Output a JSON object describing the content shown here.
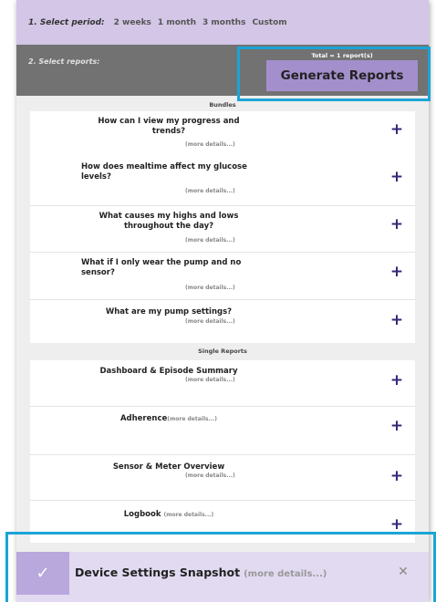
{
  "period": {
    "label": "1. Select period:",
    "options": [
      "2 weeks",
      "1 month",
      "3 months",
      "Custom"
    ]
  },
  "reports": {
    "label": "2. Select reports:",
    "total": "Total = 1 report(s)",
    "generate_label": "Generate Reports"
  },
  "bundles": {
    "heading": "Bundles",
    "items": [
      {
        "title": "How can I view my progress and trends?",
        "more": "(more details...)"
      },
      {
        "title": "How does mealtime affect my glucose levels?",
        "more": "(more details...)"
      },
      {
        "title": "What causes my highs and lows throughout the day?",
        "more": "(more details...)"
      },
      {
        "title": "What if I only wear the pump and no sensor?",
        "more": "(more details...)"
      },
      {
        "title": "What are my pump settings?",
        "more": "(more details...)"
      }
    ]
  },
  "singles": {
    "heading": "Single Reports",
    "items": [
      {
        "title": "Dashboard & Episode Summary",
        "more": "(more details...)"
      },
      {
        "title": "Adherence",
        "more": "(more details...)"
      },
      {
        "title": "Sensor & Meter Overview",
        "more": "(more details...)"
      },
      {
        "title": "Logbook",
        "more": "(more details...)"
      }
    ]
  },
  "plus_glyph": "+",
  "selected": {
    "title": "Device Settings Snapshot",
    "more": "(more details...)",
    "check_glyph": "✓",
    "close_glyph": "✕"
  },
  "colors": {
    "accent": "#a48fcd",
    "highlight": "#1ba4d6",
    "plus": "#34287a"
  }
}
